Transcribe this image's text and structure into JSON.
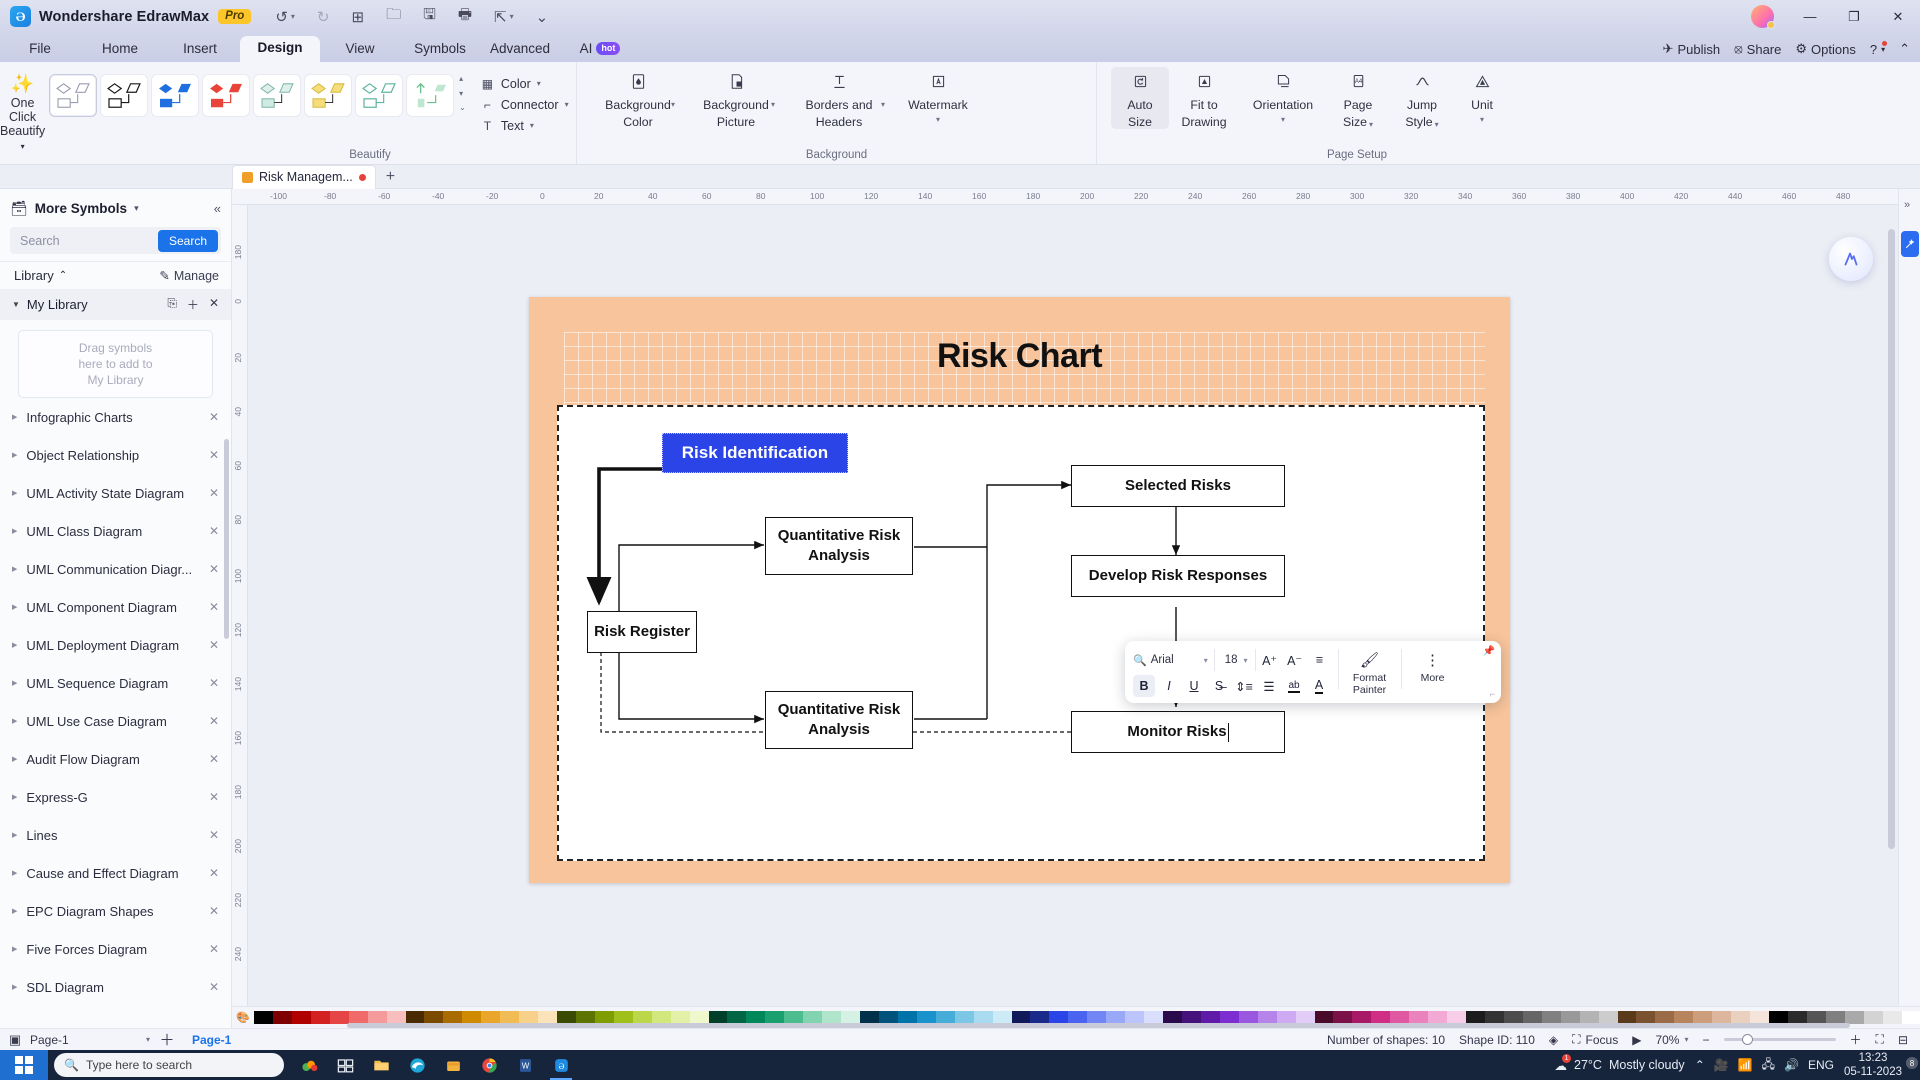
{
  "titlebar": {
    "app_name": "Wondershare EdrawMax",
    "pro_badge": "Pro",
    "quick_actions": [
      "undo-icon",
      "redo-icon",
      "new-icon",
      "open-icon",
      "save-icon",
      "print-icon",
      "export-icon",
      "more-icon"
    ],
    "window_buttons": [
      "minimize",
      "maximize",
      "close"
    ]
  },
  "menubar": {
    "items": [
      {
        "label": "File",
        "active": false
      },
      {
        "label": "Home",
        "active": false
      },
      {
        "label": "Insert",
        "active": false
      },
      {
        "label": "Design",
        "active": true
      },
      {
        "label": "View",
        "active": false
      },
      {
        "label": "Symbols",
        "active": false
      },
      {
        "label": "Advanced",
        "active": false
      }
    ],
    "ai_label": "AI",
    "ai_badge": "hot",
    "right": {
      "publish": "Publish",
      "share": "Share",
      "options": "Options",
      "help": "?"
    }
  },
  "ribbon": {
    "one_click": {
      "line1": "One Click",
      "line2": "Beautify"
    },
    "beautify_group_label": "Beautify",
    "background_group_label": "Background",
    "pagesetup_group_label": "Page Setup",
    "style_tiles": [
      {
        "name": "style-plain",
        "fill": "none",
        "stroke": "#8b8d9e",
        "selected": true
      },
      {
        "name": "style-outline",
        "fill": "none",
        "stroke": "#1a1a1a",
        "selected": false
      },
      {
        "name": "style-blue",
        "fill": "#1f6fe0",
        "stroke": "#1f6fe0",
        "selected": false
      },
      {
        "name": "style-red",
        "fill": "#e8443a",
        "stroke": "#e8443a",
        "selected": false
      },
      {
        "name": "style-mint",
        "fill": "#cfe9e3",
        "stroke": "#7fb8ab",
        "selected": false
      },
      {
        "name": "style-yellow",
        "fill": "#f5dd7a",
        "stroke": "#d8bc42",
        "selected": false
      },
      {
        "name": "style-teal",
        "fill": "#ffffff",
        "stroke": "#5fb3a1",
        "selected": false
      },
      {
        "name": "style-green-arrow",
        "fill": "#bfe6cf",
        "stroke": "#6cbf8e",
        "selected": false
      }
    ],
    "quick_items": [
      {
        "label": "Color",
        "icon": "color-grid-icon",
        "caret": true
      },
      {
        "label": "Connector",
        "icon": "connector-icon",
        "caret": true
      },
      {
        "label": "Text",
        "icon": "text-T-icon",
        "caret": true
      }
    ],
    "background_buttons": [
      {
        "label_1": "Background",
        "label_2": "Color",
        "icon": "droplet-page-icon",
        "caret": true
      },
      {
        "label_1": "Background",
        "label_2": "Picture",
        "icon": "picture-page-icon",
        "caret": true
      },
      {
        "label_1": "Borders and",
        "label_2": "Headers",
        "icon": "borders-T-icon",
        "caret": true
      },
      {
        "label_1": "Watermark",
        "label_2": "",
        "icon": "watermark-A-icon",
        "caret": true
      }
    ],
    "pagesetup_buttons": [
      {
        "label_1": "Auto",
        "label_2": "Size",
        "icon": "auto-size-icon",
        "caret": false,
        "selected": true
      },
      {
        "label_1": "Fit to",
        "label_2": "Drawing",
        "icon": "fit-drawing-icon",
        "caret": false,
        "selected": false
      },
      {
        "label_1": "Orientation",
        "label_2": "",
        "icon": "orientation-icon",
        "caret": true,
        "selected": false
      },
      {
        "label_1": "Page",
        "label_2": "Size",
        "icon": "page-size-a4-icon",
        "caret": true,
        "selected": false
      },
      {
        "label_1": "Jump",
        "label_2": "Style",
        "icon": "jump-style-icon",
        "caret": true,
        "selected": false
      },
      {
        "label_1": "Unit",
        "label_2": "",
        "icon": "unit-triangle-icon",
        "caret": true,
        "selected": false
      }
    ]
  },
  "tabstrip": {
    "document_tab": "Risk Managem...",
    "add_tab": "+",
    "modified": true
  },
  "sidebar": {
    "title": "More Symbols",
    "search_placeholder": "Search",
    "search_value": "",
    "search_button": "Search",
    "library_label": "Library",
    "manage_label": "Manage",
    "my_library_label": "My Library",
    "dropzone_lines": [
      "Drag symbols",
      "here to add to",
      "My Library"
    ],
    "items": [
      {
        "label": "Infographic Charts"
      },
      {
        "label": "Object Relationship"
      },
      {
        "label": "UML Activity State Diagram"
      },
      {
        "label": "UML Class Diagram"
      },
      {
        "label": "UML Communication Diagr..."
      },
      {
        "label": "UML Component Diagram"
      },
      {
        "label": "UML Deployment Diagram"
      },
      {
        "label": "UML Sequence Diagram"
      },
      {
        "label": "UML Use Case Diagram"
      },
      {
        "label": "Audit Flow Diagram"
      },
      {
        "label": "Express-G"
      },
      {
        "label": "Lines"
      },
      {
        "label": "Cause and Effect Diagram"
      },
      {
        "label": "EPC Diagram Shapes"
      },
      {
        "label": "Five Forces Diagram"
      },
      {
        "label": "SDL Diagram"
      }
    ]
  },
  "canvas": {
    "ruler_h_ticks": [
      "-100",
      "-80",
      "-60",
      "-40",
      "-20",
      "0",
      "20",
      "40",
      "60",
      "80",
      "100",
      "120",
      "140",
      "160",
      "180",
      "200",
      "220",
      "240",
      "260",
      "280",
      "300",
      "320",
      "340",
      "360",
      "380",
      "400",
      "420",
      "440",
      "460",
      "480"
    ],
    "ruler_v_ticks": [
      "180",
      "0",
      "20",
      "40",
      "60",
      "80",
      "100",
      "120",
      "140",
      "160",
      "180",
      "200",
      "220",
      "240"
    ],
    "page_title": "Risk Chart",
    "nodes": [
      {
        "id": "risk-identification",
        "label": "Risk Identification",
        "selected": true,
        "fill": "#2b44e8",
        "text_color": "#ffffff"
      },
      {
        "id": "selected-risks",
        "label": "Selected Risks",
        "selected": false,
        "fill": "#ffffff",
        "text_color": "#111111"
      },
      {
        "id": "quantitative-risk-analysis-top",
        "label": "Quantitative Risk Analysis",
        "selected": false,
        "fill": "#ffffff",
        "text_color": "#111111"
      },
      {
        "id": "develop-risk-responses",
        "label": "Develop Risk Responses",
        "selected": false,
        "fill": "#ffffff",
        "text_color": "#111111"
      },
      {
        "id": "risk-register",
        "label": "Risk Register",
        "selected": false,
        "fill": "#ffffff",
        "text_color": "#111111"
      },
      {
        "id": "quantitative-risk-analysis-bottom",
        "label": "Quantitative Risk Analysis",
        "selected": false,
        "fill": "#ffffff",
        "text_color": "#111111"
      },
      {
        "id": "monitor-risks",
        "label": "Monitor Risks",
        "selected": false,
        "fill": "#ffffff",
        "text_color": "#111111",
        "editing": true
      }
    ],
    "page_bg_color": "#f7c49b"
  },
  "format_toolbar": {
    "font_name": "Arial",
    "font_size": "18",
    "buttons_row1": [
      "grow-font-icon",
      "shrink-font-icon",
      "align-icon"
    ],
    "buttons_row2": [
      "bold-icon",
      "italic-icon",
      "underline-icon",
      "strikethrough-icon",
      "line-spacing-icon",
      "bullet-list-icon",
      "highlight-icon",
      "font-color-icon"
    ],
    "format_painter": {
      "line1": "Format",
      "line2": "Painter"
    },
    "more": "More",
    "bold_active": true
  },
  "statusbar": {
    "page_selector": "Page-1",
    "page_tab": "Page-1",
    "shapes_count": "Number of shapes: 10",
    "shape_id": "Shape ID: 110",
    "focus": "Focus",
    "zoom": "70%",
    "layers_icon": "layers-icon",
    "play_icon": "play-icon",
    "fullscreen_icon": "fullscreen-icon",
    "fitwidth_icon": "fit-width-icon"
  },
  "taskbar": {
    "search_placeholder": "Type here to search",
    "apps": [
      "task-view-icon",
      "file-explorer-icon",
      "edge-icon",
      "store-icon",
      "chrome-icon",
      "word-icon",
      "edraw-icon"
    ],
    "weather_temp": "27°C",
    "weather_desc": "Mostly cloudy",
    "language": "ENG",
    "time": "13:23",
    "date": "05-11-2023",
    "notification_count": "8"
  },
  "colors": {
    "accent": "#1a73e8",
    "page_bg": "#f7c49b",
    "selected_node": "#2b44e8",
    "taskbar": "#16243c",
    "ribbon_bg": "#f4f5fa",
    "titlebar_bg": "#d2d6ea"
  },
  "swatch_colors": [
    "#000000",
    "#7f0000",
    "#b00000",
    "#d32020",
    "#e64545",
    "#f06a6a",
    "#f59a9a",
    "#f8bdbd",
    "#4a2a00",
    "#7a4a00",
    "#a86c00",
    "#d08a00",
    "#eaa62a",
    "#f2bc55",
    "#f7d18a",
    "#fae3b8",
    "#3a4a00",
    "#5e7400",
    "#7f9c00",
    "#9fbf1a",
    "#bcd84a",
    "#d2e77c",
    "#e3f0a8",
    "#eff7cc",
    "#00402a",
    "#006644",
    "#00875a",
    "#1aa06e",
    "#4cbd8e",
    "#82d4b0",
    "#b0e5cc",
    "#d5f1e3",
    "#00304a",
    "#00527a",
    "#0073a8",
    "#1a93cc",
    "#45add8",
    "#7cc7e6",
    "#a8dbef",
    "#cdebf7",
    "#101a5a",
    "#1a2a8a",
    "#2b44e8",
    "#4a63f0",
    "#7285f5",
    "#9aa8f8",
    "#bcc5fb",
    "#d9defd",
    "#2a0a4a",
    "#44127a",
    "#5f1aa8",
    "#7d2ed0",
    "#9a57e0",
    "#b583ea",
    "#cdaaf2",
    "#e2cdf8",
    "#4a0a2a",
    "#7a1248",
    "#a81a66",
    "#d02e85",
    "#e057a2",
    "#ea83bd",
    "#f2aad4",
    "#f8cde7",
    "#1c1c1c",
    "#333333",
    "#4d4d4d",
    "#666666",
    "#808080",
    "#999999",
    "#b3b3b3",
    "#cccccc",
    "#5a3a1a",
    "#7a5230",
    "#9a6b46",
    "#b8845e",
    "#cc9e7c",
    "#ddb79d",
    "#ead0bf",
    "#f4e4da",
    "#000000",
    "#2b2b2b",
    "#555555",
    "#7f7f7f",
    "#a9a9a9",
    "#d3d3d3",
    "#e9e9e9",
    "#ffffff"
  ]
}
